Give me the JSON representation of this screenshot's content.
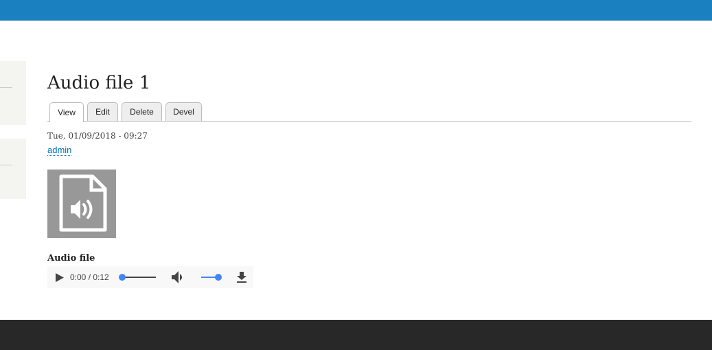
{
  "page": {
    "title": "Audio file 1"
  },
  "tabs": [
    {
      "label": "View"
    },
    {
      "label": "Edit"
    },
    {
      "label": "Delete"
    },
    {
      "label": "Devel"
    }
  ],
  "meta": {
    "date": "Tue, 01/09/2018 - 09:27",
    "author": "admin"
  },
  "field": {
    "label": "Audio file"
  },
  "player": {
    "time": "0:00 / 0:12",
    "progress": 0,
    "volume": 1.0
  },
  "colors": {
    "topbar": "#1b80c0",
    "footer": "#282828",
    "accent": "#4285f4"
  }
}
